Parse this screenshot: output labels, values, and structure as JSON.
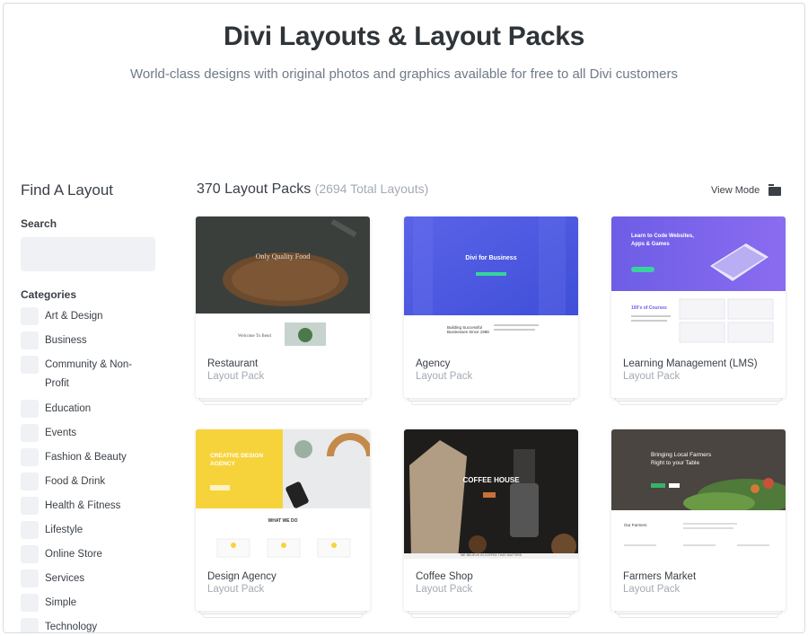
{
  "header": {
    "title": "Divi Layouts & Layout Packs",
    "subtitle": "World-class designs with original photos and graphics available for free to all Divi customers"
  },
  "sidebar": {
    "title": "Find A Layout",
    "search_label": "Search",
    "search_value": "",
    "categories_label": "Categories",
    "categories": [
      {
        "label": "Art & Design"
      },
      {
        "label": "Business"
      },
      {
        "label": "Community & Non-Profit"
      },
      {
        "label": "Education"
      },
      {
        "label": "Events"
      },
      {
        "label": "Fashion & Beauty"
      },
      {
        "label": "Food & Drink"
      },
      {
        "label": "Health & Fitness"
      },
      {
        "label": "Lifestyle"
      },
      {
        "label": "Online Store"
      },
      {
        "label": "Services"
      },
      {
        "label": "Simple"
      },
      {
        "label": "Technology"
      }
    ]
  },
  "main": {
    "count_label": "370 Layout Packs",
    "total_label": "(2694 Total Layouts)",
    "view_mode_label": "View Mode",
    "view_mode_icon": "grid-view-icon"
  },
  "cards": [
    {
      "name": "Restaurant",
      "type": "Layout Pack",
      "thumb_text": "Only Quality Food",
      "thumb_text2": "Welcome To Bend"
    },
    {
      "name": "Agency",
      "type": "Layout Pack",
      "thumb_text": "Divi for Business",
      "thumb_text2": "Building Successful Businesses Since 1988"
    },
    {
      "name": "Learning Management (LMS)",
      "type": "Layout Pack",
      "thumb_text": "Learn to Code Websites, Apps & Games",
      "thumb_text2": "100's of Courses"
    },
    {
      "name": "Design Agency",
      "type": "Layout Pack",
      "thumb_text": "CREATIVE DESIGN AGENCY",
      "thumb_text2": "WHAT WE DO"
    },
    {
      "name": "Coffee Shop",
      "type": "Layout Pack",
      "thumb_text": "COFFEE HOUSE",
      "thumb_text2": "WE BELIEVE IN COFFEE THAT MATTERS"
    },
    {
      "name": "Farmers Market",
      "type": "Layout Pack",
      "thumb_text": "Bringing Local Farmers Right to your Table",
      "thumb_text2": "Our Farmers"
    }
  ],
  "colors": {
    "accent_purple": "#6c5ce7",
    "agency_blue": "#4a5be0",
    "design_yellow": "#f7d33b",
    "muted_text": "#a4aab3"
  }
}
